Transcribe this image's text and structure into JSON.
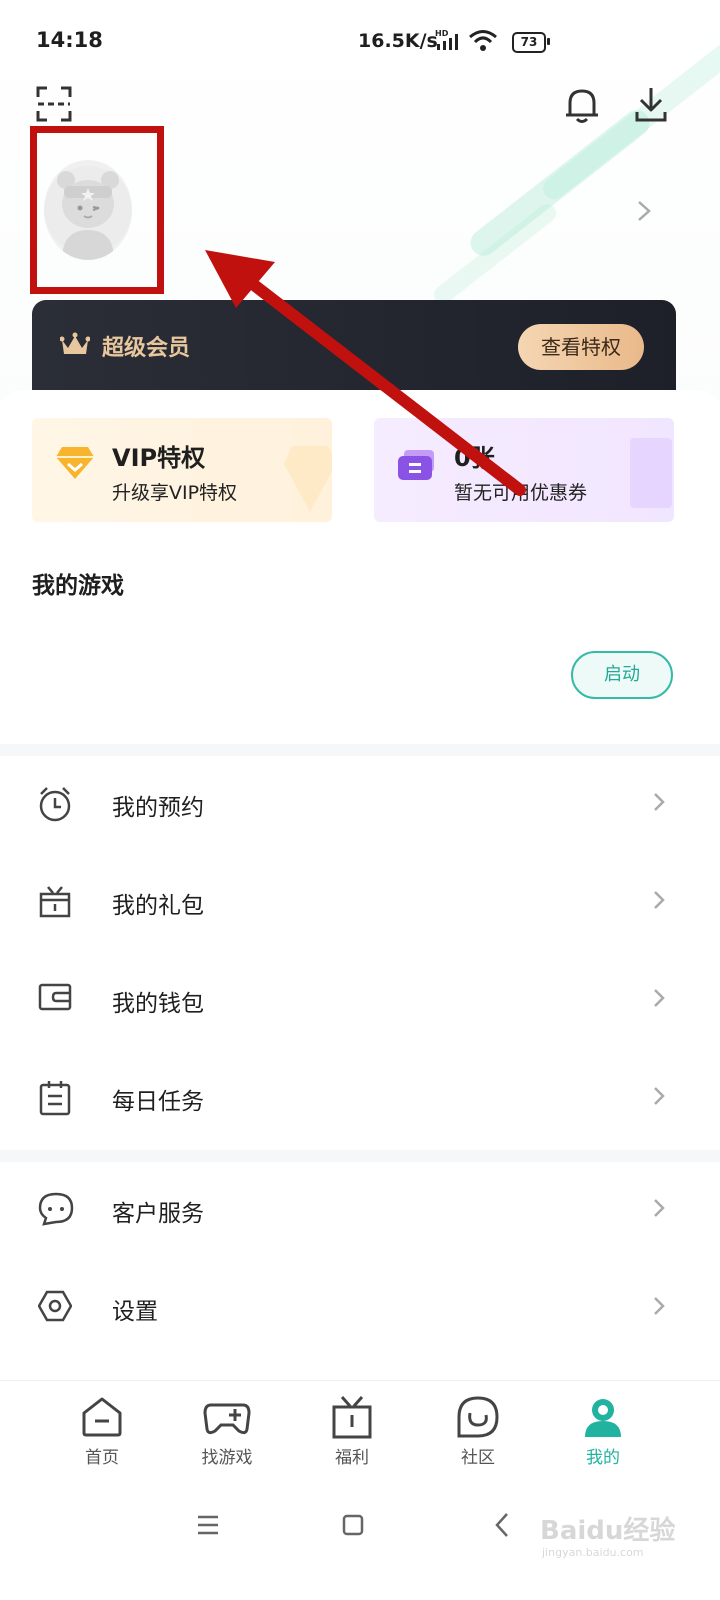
{
  "status_bar": {
    "time": "14:18",
    "network_speed": "16.5K/s",
    "hd_label": "HD",
    "battery": "73"
  },
  "header": {
    "scan_icon": "scan-icon",
    "bell_icon": "bell-icon",
    "download_icon": "download-icon"
  },
  "vip_banner": {
    "title": "超级会员",
    "button": "查看特权"
  },
  "cards": {
    "vip": {
      "title": "VIP特权",
      "subtitle": "升级享VIP特权"
    },
    "coupon": {
      "title": "0张",
      "subtitle": "暂无可用优惠券"
    }
  },
  "my_games": {
    "title": "我的游戏",
    "start_button": "启动"
  },
  "menu_group_1": [
    {
      "label": "我的预约",
      "icon": "alarm-clock-icon"
    },
    {
      "label": "我的礼包",
      "icon": "gift-icon"
    },
    {
      "label": "我的钱包",
      "icon": "wallet-icon"
    },
    {
      "label": "每日任务",
      "icon": "task-list-icon"
    }
  ],
  "menu_group_2": [
    {
      "label": "客户服务",
      "icon": "chat-bubble-icon"
    },
    {
      "label": "设置",
      "icon": "settings-hexagon-icon"
    }
  ],
  "bottom_nav": [
    {
      "label": "首页",
      "icon": "home-icon",
      "active": false
    },
    {
      "label": "找游戏",
      "icon": "gamepad-icon",
      "active": false
    },
    {
      "label": "福利",
      "icon": "gift-box-icon",
      "active": false
    },
    {
      "label": "社区",
      "icon": "community-icon",
      "active": false
    },
    {
      "label": "我的",
      "icon": "person-icon",
      "active": true
    }
  ],
  "watermark": {
    "text": "Baidu经验",
    "sub": "jingyan.baidu.com"
  },
  "colors": {
    "accent": "#22b3a0",
    "annotation": "#c0110f",
    "vip_gold": "#e9c79e"
  }
}
